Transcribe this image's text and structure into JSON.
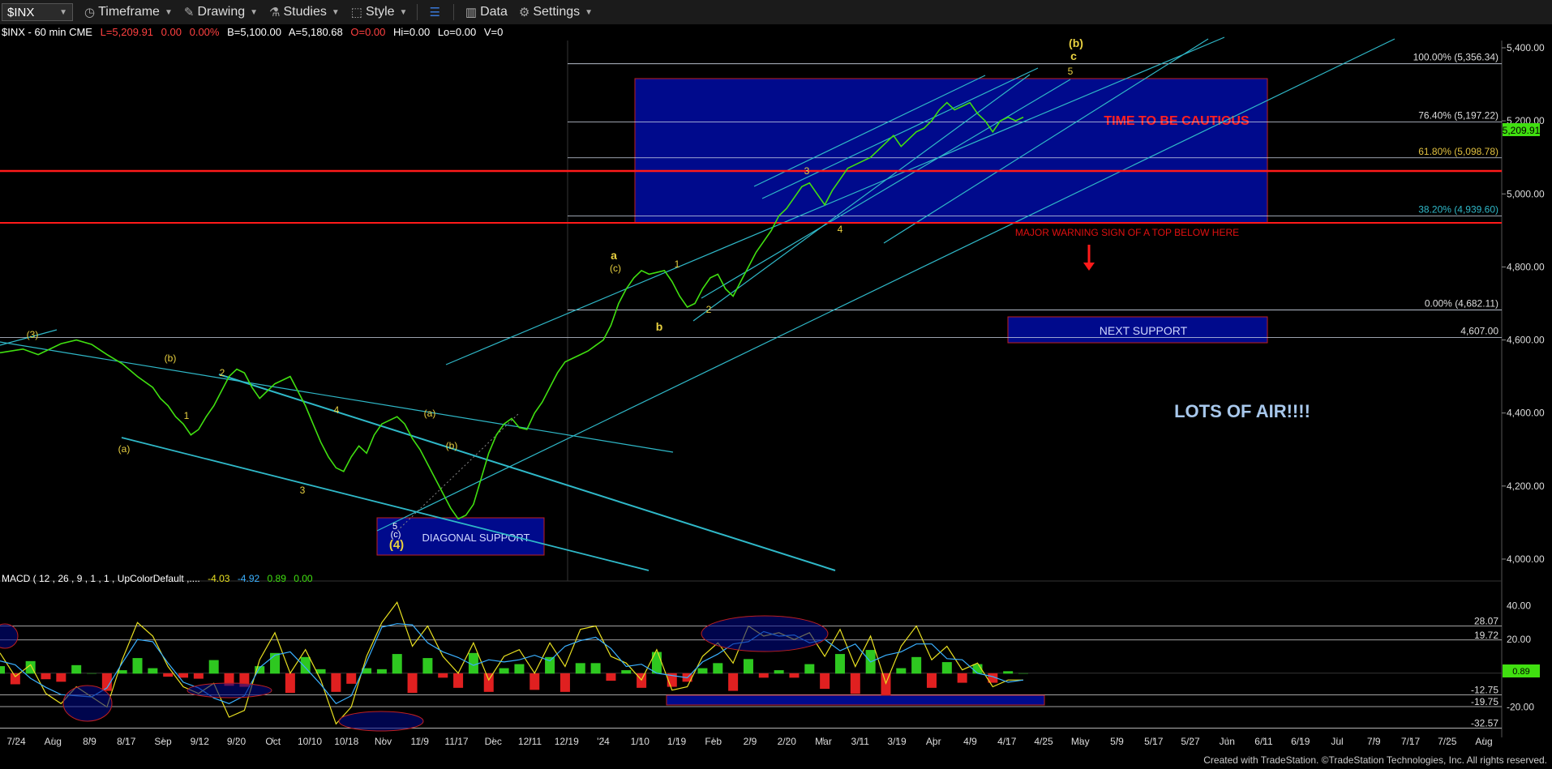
{
  "toolbar": {
    "symbol": "$INX",
    "items": [
      {
        "label": "Timeframe",
        "icon": "clock-icon"
      },
      {
        "label": "Drawing",
        "icon": "pencil-icon"
      },
      {
        "label": "Studies",
        "icon": "flask-icon"
      },
      {
        "label": "Style",
        "icon": "style-icon"
      },
      {
        "label": "Data",
        "icon": "bar-chart-icon"
      },
      {
        "label": "Settings",
        "icon": "gear-icon"
      }
    ]
  },
  "price_header": {
    "symbol": "$INX - 60 min  CME",
    "last": "L=5,209.91",
    "change": "0.00",
    "pct": "0.00%",
    "bid": "B=5,100.00",
    "ask": "A=5,180.68",
    "open": "O=0.00",
    "hi": "Hi=0.00",
    "lo": "Lo=0.00",
    "vol": "V=0"
  },
  "macd_header": {
    "label": "MACD ( 12 , 26 , 9 , 1 , 1 , UpColorDefault ,....",
    "v1": "-4.03",
    "v2": "-4.92",
    "v3": "0.89",
    "v4": "0.00"
  },
  "chart_data": {
    "type": "line",
    "title": "$INX - 60 min",
    "price_axis": {
      "ylim": [
        3940,
        5420
      ],
      "ticks": [
        "5,400.00",
        "5,200.00",
        "5,000.00",
        "4,800.00",
        "4,600.00",
        "4,400.00",
        "4,200.00",
        "4,000.00"
      ],
      "tick_values": [
        5400,
        5200,
        5000,
        4800,
        4600,
        4400,
        4200,
        4000
      ]
    },
    "macd_axis": {
      "ylim": [
        -38,
        46
      ],
      "ticks": [
        "40.00",
        "20.00",
        "-20.00"
      ],
      "tick_values": [
        40,
        20,
        -20
      ],
      "levels": [
        {
          "label": "28.07",
          "value": 28.07
        },
        {
          "label": "19.72",
          "value": 19.72
        },
        {
          "label": "-12.75",
          "value": -12.75
        },
        {
          "label": "-19.75",
          "value": -19.75
        },
        {
          "label": "-32.57",
          "value": -32.57
        }
      ],
      "current": "0.89"
    },
    "x_ticks": [
      "7/24",
      "Aug",
      "8/9",
      "8/17",
      "Sep",
      "9/12",
      "9/20",
      "Oct",
      "10/10",
      "10/18",
      "Nov",
      "11/9",
      "11/17",
      "Dec",
      "12/11",
      "12/19",
      "'24",
      "1/10",
      "1/19",
      "Feb",
      "2/9",
      "2/20",
      "Mar",
      "3/11",
      "3/19",
      "Apr",
      "4/9",
      "4/17",
      "4/25",
      "May",
      "5/9",
      "5/17",
      "5/27",
      "Jun",
      "6/11",
      "6/19",
      "Jul",
      "7/9",
      "7/17",
      "7/25",
      "Aug"
    ],
    "price_series": {
      "name": "$INX",
      "points": [
        [
          0,
          4565
        ],
        [
          3,
          4575
        ],
        [
          5,
          4560
        ],
        [
          8,
          4590
        ],
        [
          10,
          4600
        ],
        [
          12,
          4588
        ],
        [
          14,
          4560
        ],
        [
          16,
          4535
        ],
        [
          18,
          4500
        ],
        [
          20,
          4470
        ],
        [
          21,
          4440
        ],
        [
          22,
          4420
        ],
        [
          23,
          4390
        ],
        [
          24,
          4370
        ],
        [
          25,
          4340
        ],
        [
          26,
          4355
        ],
        [
          27,
          4390
        ],
        [
          28,
          4420
        ],
        [
          29,
          4460
        ],
        [
          30,
          4500
        ],
        [
          31,
          4520
        ],
        [
          32,
          4510
        ],
        [
          33,
          4470
        ],
        [
          34,
          4440
        ],
        [
          35,
          4460
        ],
        [
          36,
          4480
        ],
        [
          37,
          4490
        ],
        [
          38,
          4500
        ],
        [
          39,
          4460
        ],
        [
          40,
          4420
        ],
        [
          41,
          4370
        ],
        [
          42,
          4320
        ],
        [
          43,
          4280
        ],
        [
          44,
          4250
        ],
        [
          45,
          4240
        ],
        [
          46,
          4280
        ],
        [
          47,
          4310
        ],
        [
          48,
          4290
        ],
        [
          49,
          4340
        ],
        [
          50,
          4370
        ],
        [
          51,
          4380
        ],
        [
          52,
          4390
        ],
        [
          53,
          4370
        ],
        [
          54,
          4330
        ],
        [
          55,
          4300
        ],
        [
          56,
          4260
        ],
        [
          57,
          4220
        ],
        [
          58,
          4180
        ],
        [
          59,
          4140
        ],
        [
          60,
          4110
        ],
        [
          61,
          4120
        ],
        [
          62,
          4150
        ],
        [
          63,
          4220
        ],
        [
          64,
          4290
        ],
        [
          65,
          4340
        ],
        [
          66,
          4370
        ],
        [
          67,
          4385
        ],
        [
          68,
          4360
        ],
        [
          69,
          4355
        ],
        [
          70,
          4400
        ],
        [
          71,
          4430
        ],
        [
          72,
          4470
        ],
        [
          73,
          4510
        ],
        [
          74,
          4540
        ],
        [
          75,
          4550
        ],
        [
          76,
          4560
        ],
        [
          77,
          4570
        ],
        [
          78,
          4585
        ],
        [
          79,
          4600
        ],
        [
          80,
          4640
        ],
        [
          81,
          4700
        ],
        [
          82,
          4740
        ],
        [
          83,
          4770
        ],
        [
          84,
          4790
        ],
        [
          85,
          4780
        ],
        [
          86,
          4785
        ],
        [
          87,
          4790
        ],
        [
          88,
          4760
        ],
        [
          89,
          4720
        ],
        [
          90,
          4690
        ],
        [
          91,
          4700
        ],
        [
          92,
          4740
        ],
        [
          93,
          4770
        ],
        [
          94,
          4780
        ],
        [
          95,
          4740
        ],
        [
          96,
          4720
        ],
        [
          97,
          4760
        ],
        [
          98,
          4800
        ],
        [
          99,
          4840
        ],
        [
          100,
          4870
        ],
        [
          101,
          4900
        ],
        [
          102,
          4940
        ],
        [
          103,
          4960
        ],
        [
          104,
          4990
        ],
        [
          105,
          5020
        ],
        [
          106,
          5030
        ],
        [
          107,
          5000
        ],
        [
          108,
          4970
        ],
        [
          109,
          5010
        ],
        [
          110,
          5040
        ],
        [
          111,
          5070
        ],
        [
          112,
          5080
        ],
        [
          113,
          5090
        ],
        [
          114,
          5100
        ],
        [
          115,
          5120
        ],
        [
          116,
          5140
        ],
        [
          117,
          5160
        ],
        [
          118,
          5130
        ],
        [
          119,
          5150
        ],
        [
          120,
          5170
        ],
        [
          121,
          5180
        ],
        [
          122,
          5200
        ],
        [
          123,
          5230
        ],
        [
          124,
          5250
        ],
        [
          125,
          5230
        ],
        [
          126,
          5240
        ],
        [
          127,
          5250
        ],
        [
          128,
          5220
        ],
        [
          129,
          5200
        ],
        [
          130,
          5170
        ],
        [
          131,
          5200
        ],
        [
          132,
          5210
        ],
        [
          133,
          5200
        ],
        [
          134,
          5210
        ]
      ]
    },
    "macd_series": {
      "name": "MACD",
      "points": [
        [
          0,
          12
        ],
        [
          2,
          -2
        ],
        [
          4,
          5
        ],
        [
          6,
          -12
        ],
        [
          8,
          -18
        ],
        [
          10,
          -8
        ],
        [
          12,
          -14
        ],
        [
          14,
          -20
        ],
        [
          16,
          8
        ],
        [
          18,
          30
        ],
        [
          20,
          22
        ],
        [
          22,
          4
        ],
        [
          24,
          -8
        ],
        [
          26,
          -12
        ],
        [
          28,
          -6
        ],
        [
          30,
          -26
        ],
        [
          32,
          -22
        ],
        [
          34,
          8
        ],
        [
          36,
          24
        ],
        [
          38,
          0
        ],
        [
          40,
          14
        ],
        [
          42,
          -4
        ],
        [
          44,
          -30
        ],
        [
          46,
          -20
        ],
        [
          48,
          10
        ],
        [
          50,
          30
        ],
        [
          52,
          42
        ],
        [
          54,
          16
        ],
        [
          56,
          28
        ],
        [
          58,
          10
        ],
        [
          60,
          0
        ],
        [
          62,
          18
        ],
        [
          64,
          -4
        ],
        [
          66,
          10
        ],
        [
          68,
          14
        ],
        [
          70,
          0
        ],
        [
          72,
          18
        ],
        [
          74,
          4
        ],
        [
          76,
          26
        ],
        [
          78,
          28
        ],
        [
          80,
          10
        ],
        [
          82,
          6
        ],
        [
          84,
          -4
        ],
        [
          86,
          14
        ],
        [
          88,
          -10
        ],
        [
          90,
          -8
        ],
        [
          92,
          10
        ],
        [
          94,
          18
        ],
        [
          96,
          6
        ],
        [
          98,
          28
        ],
        [
          100,
          22
        ],
        [
          102,
          24
        ],
        [
          104,
          20
        ],
        [
          106,
          24
        ],
        [
          108,
          10
        ],
        [
          110,
          26
        ],
        [
          112,
          4
        ],
        [
          114,
          22
        ],
        [
          116,
          -6
        ],
        [
          118,
          16
        ],
        [
          120,
          28
        ],
        [
          122,
          8
        ],
        [
          124,
          16
        ],
        [
          126,
          2
        ],
        [
          128,
          6
        ],
        [
          130,
          -8
        ],
        [
          132,
          -4
        ],
        [
          134,
          -4
        ]
      ]
    },
    "annotations": {
      "boxes": [
        {
          "label": "TIME TO BE CAUTIOUS"
        },
        {
          "label": "NEXT SUPPORT"
        },
        {
          "label": "DIAGONAL SUPPORT"
        }
      ],
      "texts": [
        {
          "label": "MAJOR WARNING SIGN OF A TOP BELOW HERE"
        },
        {
          "label": "LOTS OF AIR!!!!"
        }
      ],
      "fib_levels": [
        {
          "label": "100.00% (5,356.34)",
          "value": 5356.34
        },
        {
          "label": "76.40% (5,197.22)",
          "value": 5197.22
        },
        {
          "label": "61.80% (5,098.78)",
          "value": 5098.78
        },
        {
          "label": "38.20% (4,939.60)",
          "value": 4939.6
        },
        {
          "label": "0.00% (4,682.11)",
          "value": 4682.11
        },
        {
          "label": "4,607.00",
          "value": 4607
        }
      ],
      "red_lines": [
        5095,
        4950
      ],
      "current_price": "5,209.91",
      "wave_labels": [
        "(3)",
        "(a)",
        "(b)",
        "1",
        "2",
        "3",
        "4",
        "5",
        "(c)",
        "(4)",
        "(a)",
        "(b)",
        "(c)",
        "a",
        "b",
        "1",
        "2",
        "3",
        "4",
        "5",
        "c",
        "(b)"
      ]
    }
  },
  "footer": {
    "credit": "Created with TradeStation. ©TradeStation Technologies, Inc. All rights reserved."
  }
}
